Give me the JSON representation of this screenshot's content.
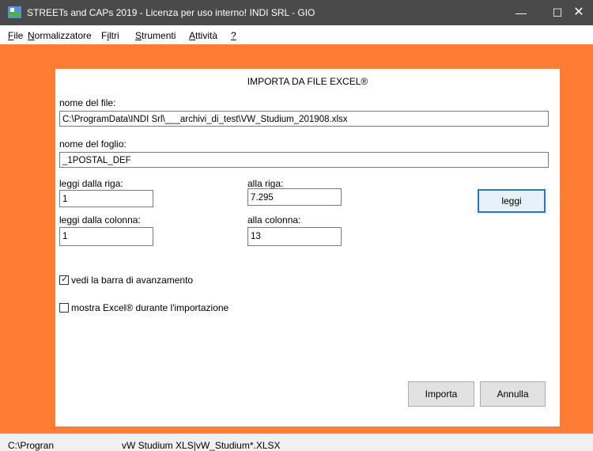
{
  "window": {
    "title": "STREETs and CAPs 2019 -  Licenza per uso interno! INDI SRL - GIO",
    "minimize_glyph": "—",
    "maximize_glyph": "☐",
    "close_glyph": "✕"
  },
  "menubar": {
    "items": [
      {
        "accel": "F",
        "rest": "ile"
      },
      {
        "accel": "N",
        "rest": "ormalizzatore"
      },
      {
        "pre": "F",
        "accel": "i",
        "rest": "ltri"
      },
      {
        "accel": "S",
        "rest": "trumenti"
      },
      {
        "accel": "A",
        "rest": "ttività"
      },
      {
        "accel": "?",
        "rest": ""
      }
    ]
  },
  "dialog": {
    "title": "IMPORTA DA FILE EXCEL®",
    "file_label": "nome del file:",
    "file_value": "C:\\ProgramData\\INDI Srl\\___archivi_di_test\\VW_Studium_201908.xlsx",
    "sheet_label": "nome del foglio:",
    "sheet_value": "_1POSTAL_DEF",
    "from_row_label": "leggi dalla riga:",
    "from_row_value": "1",
    "to_row_label": "alla riga:",
    "to_row_value": "7.295",
    "from_col_label": "leggi dalla colonna:",
    "from_col_value": "1",
    "to_col_label": "alla colonna:",
    "to_col_value": "13",
    "read_button": "leggi",
    "progress_checkbox": {
      "label": "vedi la barra di avanzamento",
      "checked": true,
      "glyph": "✓"
    },
    "excel_checkbox": {
      "label": "mostra Excel® durante l'importazione",
      "checked": false
    },
    "import_button": "Importa",
    "cancel_button": "Annulla"
  },
  "statusbar": {
    "path": "C:\\Progran",
    "info": "vW Studium XLS|vW_Studium*.XLSX"
  },
  "colors": {
    "workspace": "#fe7c33",
    "titlebar": "#4a4a4a",
    "focus_border": "#2a73c5"
  }
}
